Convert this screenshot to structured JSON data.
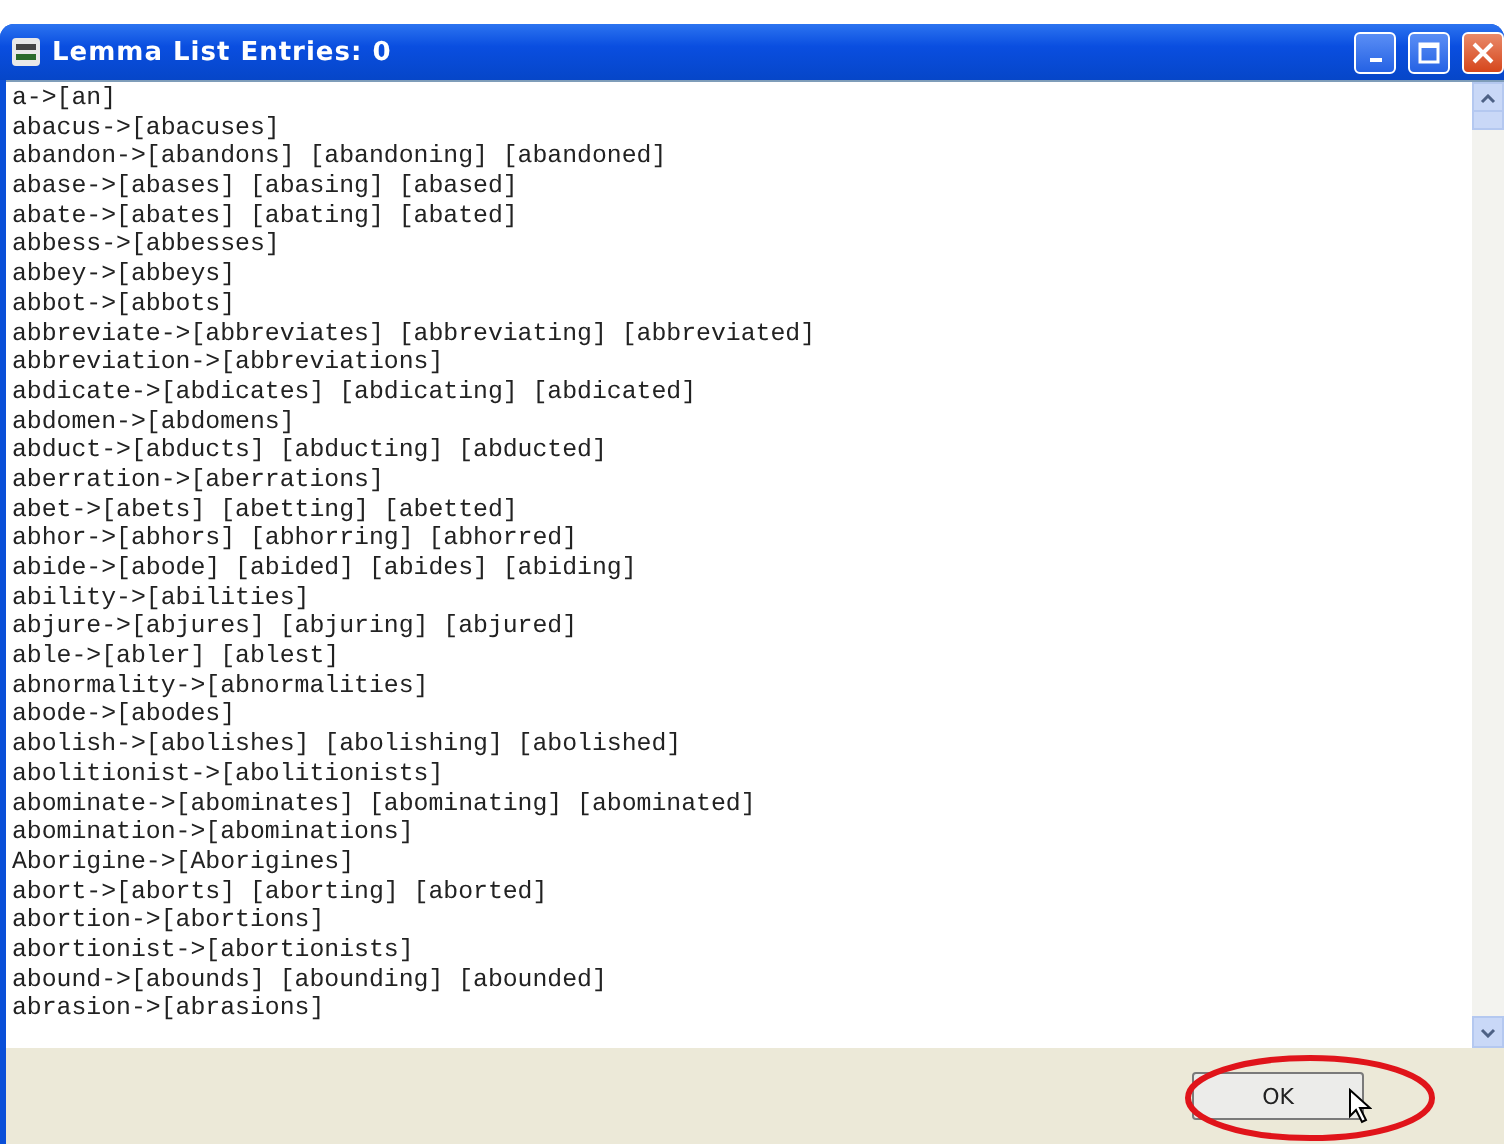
{
  "window": {
    "title": "Lemma List Entries: 0"
  },
  "lines": [
    "a->[an]",
    "abacus->[abacuses]",
    "abandon->[abandons] [abandoning] [abandoned]",
    "abase->[abases] [abasing] [abased]",
    "abate->[abates] [abating] [abated]",
    "abbess->[abbesses]",
    "abbey->[abbeys]",
    "abbot->[abbots]",
    "abbreviate->[abbreviates] [abbreviating] [abbreviated]",
    "abbreviation->[abbreviations]",
    "abdicate->[abdicates] [abdicating] [abdicated]",
    "abdomen->[abdomens]",
    "abduct->[abducts] [abducting] [abducted]",
    "aberration->[aberrations]",
    "abet->[abets] [abetting] [abetted]",
    "abhor->[abhors] [abhorring] [abhorred]",
    "abide->[abode] [abided] [abides] [abiding]",
    "ability->[abilities]",
    "abjure->[abjures] [abjuring] [abjured]",
    "able->[abler] [ablest]",
    "abnormality->[abnormalities]",
    "abode->[abodes]",
    "abolish->[abolishes] [abolishing] [abolished]",
    "abolitionist->[abolitionists]",
    "abominate->[abominates] [abominating] [abominated]",
    "abomination->[abominations]",
    "Aborigine->[Aborigines]",
    "abort->[aborts] [aborting] [aborted]",
    "abortion->[abortions]",
    "abortionist->[abortionists]",
    "abound->[abounds] [abounding] [abounded]",
    "abrasion->[abrasions]"
  ],
  "button": {
    "label": "OK"
  }
}
